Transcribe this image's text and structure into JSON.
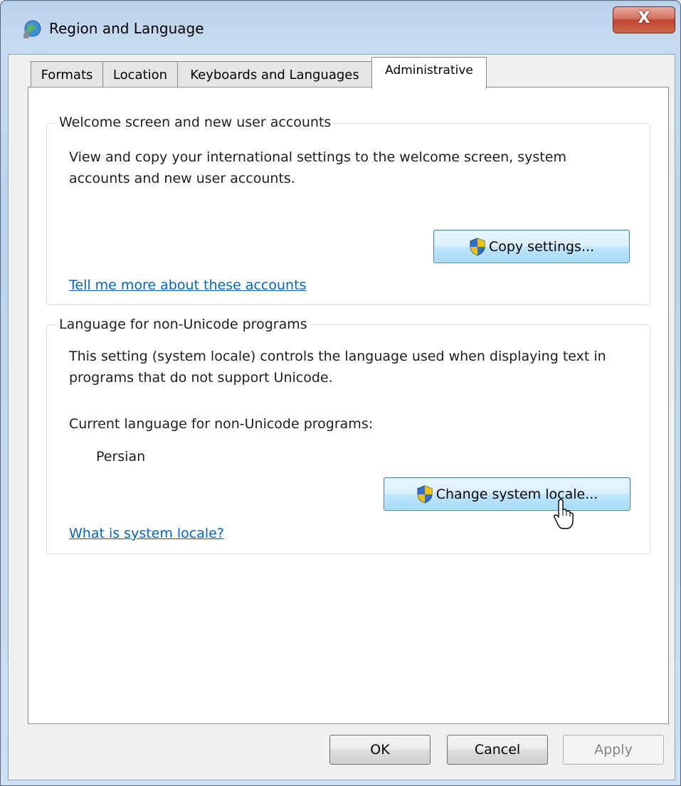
{
  "window": {
    "title": "Region and Language",
    "close_glyph": "X"
  },
  "tabs": [
    {
      "label": "Formats",
      "active": false
    },
    {
      "label": "Location",
      "active": false
    },
    {
      "label": "Keyboards and Languages",
      "active": false
    },
    {
      "label": "Administrative",
      "active": true
    }
  ],
  "welcome_group": {
    "title": "Welcome screen and new user accounts",
    "description": "View and copy your international settings to the welcome screen, system accounts and new user accounts.",
    "copy_button": "Copy settings...",
    "link": "Tell me more about these accounts"
  },
  "locale_group": {
    "title": "Language for non-Unicode programs",
    "description": "This setting (system locale) controls the language used when displaying text in programs that do not support Unicode.",
    "current_label": "Current language for non-Unicode programs:",
    "current_value": "Persian",
    "change_button": "Change system locale...",
    "link": "What is system locale?"
  },
  "footer": {
    "ok": "OK",
    "cancel": "Cancel",
    "apply": "Apply"
  },
  "icons": {
    "app": "globe-icon",
    "uac": "uac-shield-icon",
    "cursor": "mouse-pointer-icon"
  },
  "colors": {
    "link": "#0066cc",
    "close_button": "#c14531",
    "focus_button": "#a7d9f5"
  }
}
